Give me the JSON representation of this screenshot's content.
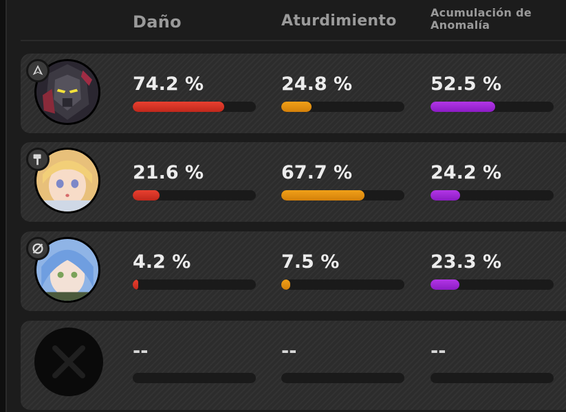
{
  "columns": {
    "damage": "Daño",
    "daze": "Aturdimiento",
    "anomaly": "Acumulación de Anomalía"
  },
  "colors": {
    "damage": "#e03a2c",
    "daze": "#e9940f",
    "anomaly": "#a52ad8",
    "row_bg": "#2c2c2c",
    "track_bg": "#1a1a1a"
  },
  "rows": [
    {
      "avatar": "armored-robot-agent-portrait",
      "role_icon": "attack-role-icon",
      "damage": "74.2 %",
      "damage_pct": 74.2,
      "daze": "24.8 %",
      "daze_pct": 24.8,
      "anomaly": "52.5 %",
      "anomaly_pct": 52.5
    },
    {
      "avatar": "blonde-agent-portrait",
      "role_icon": "stun-role-icon",
      "damage": "21.6 %",
      "damage_pct": 21.6,
      "daze": "67.7 %",
      "daze_pct": 67.7,
      "anomaly": "24.2 %",
      "anomaly_pct": 24.2
    },
    {
      "avatar": "blue-haired-agent-portrait",
      "role_icon": "anomaly-role-icon",
      "damage": "4.2 %",
      "damage_pct": 4.2,
      "daze": "7.5 %",
      "daze_pct": 7.5,
      "anomaly": "23.3 %",
      "anomaly_pct": 23.3
    },
    {
      "avatar": "empty-slot-x-icon",
      "damage": "--",
      "damage_pct": 0,
      "daze": "--",
      "daze_pct": 0,
      "anomaly": "--",
      "anomaly_pct": 0
    }
  ]
}
